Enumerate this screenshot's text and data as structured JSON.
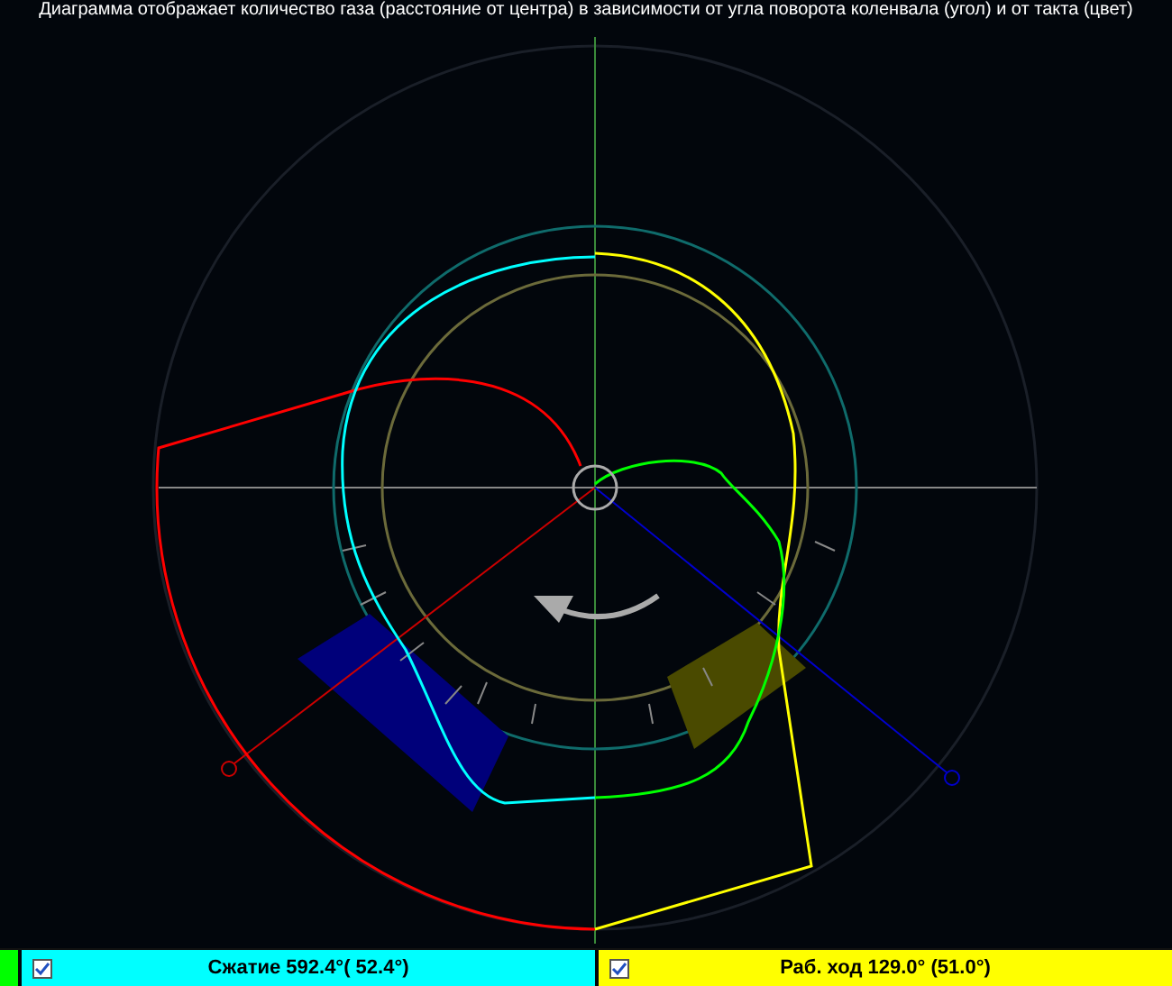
{
  "title": "Диаграмма отображает количество газа (расстояние от центра) в зависимости от угла поворота коленвала (угол) и от такта (цвет)",
  "legend": [
    {
      "kind": "swatch",
      "color": "#00ff00"
    },
    {
      "kind": "item",
      "label": "Сжатие 592.4°( 52.4°)",
      "checked": true,
      "color": "#00ffff"
    },
    {
      "kind": "item",
      "label": "Раб. ход 129.0° (51.0°)",
      "checked": true,
      "color": "#ffff00"
    }
  ]
}
